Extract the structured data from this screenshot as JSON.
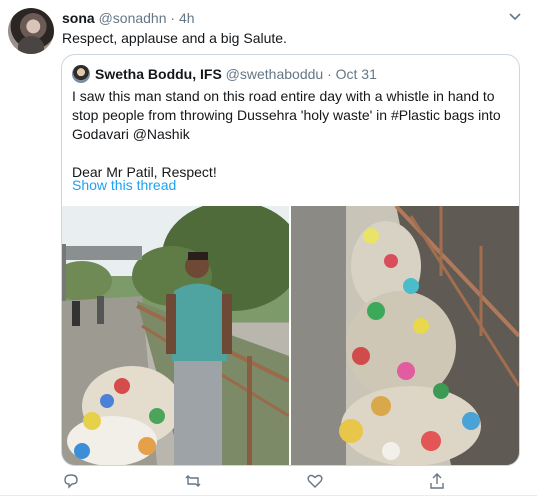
{
  "tweet": {
    "name": "sona",
    "handle": "@sonadhn",
    "separator": "·",
    "time": "4h",
    "text": "Respect,  applause and a big Salute."
  },
  "quote": {
    "name": "Swetha Boddu, IFS",
    "handle": "@swethaboddu",
    "separator": "·",
    "time": "Oct 31",
    "line1": "I saw this man stand on this road entire day with a whistle in hand to",
    "line2": "stop people from throwing Dussehra 'holy waste' in #Plastic bags into",
    "line3": "Godavari @Nashik",
    "line4": "Dear Mr Patil, Respect!",
    "show_thread": "Show this thread"
  },
  "icons": [
    "chevron-down-icon",
    "reply-icon",
    "retweet-icon",
    "like-icon",
    "share-icon"
  ]
}
